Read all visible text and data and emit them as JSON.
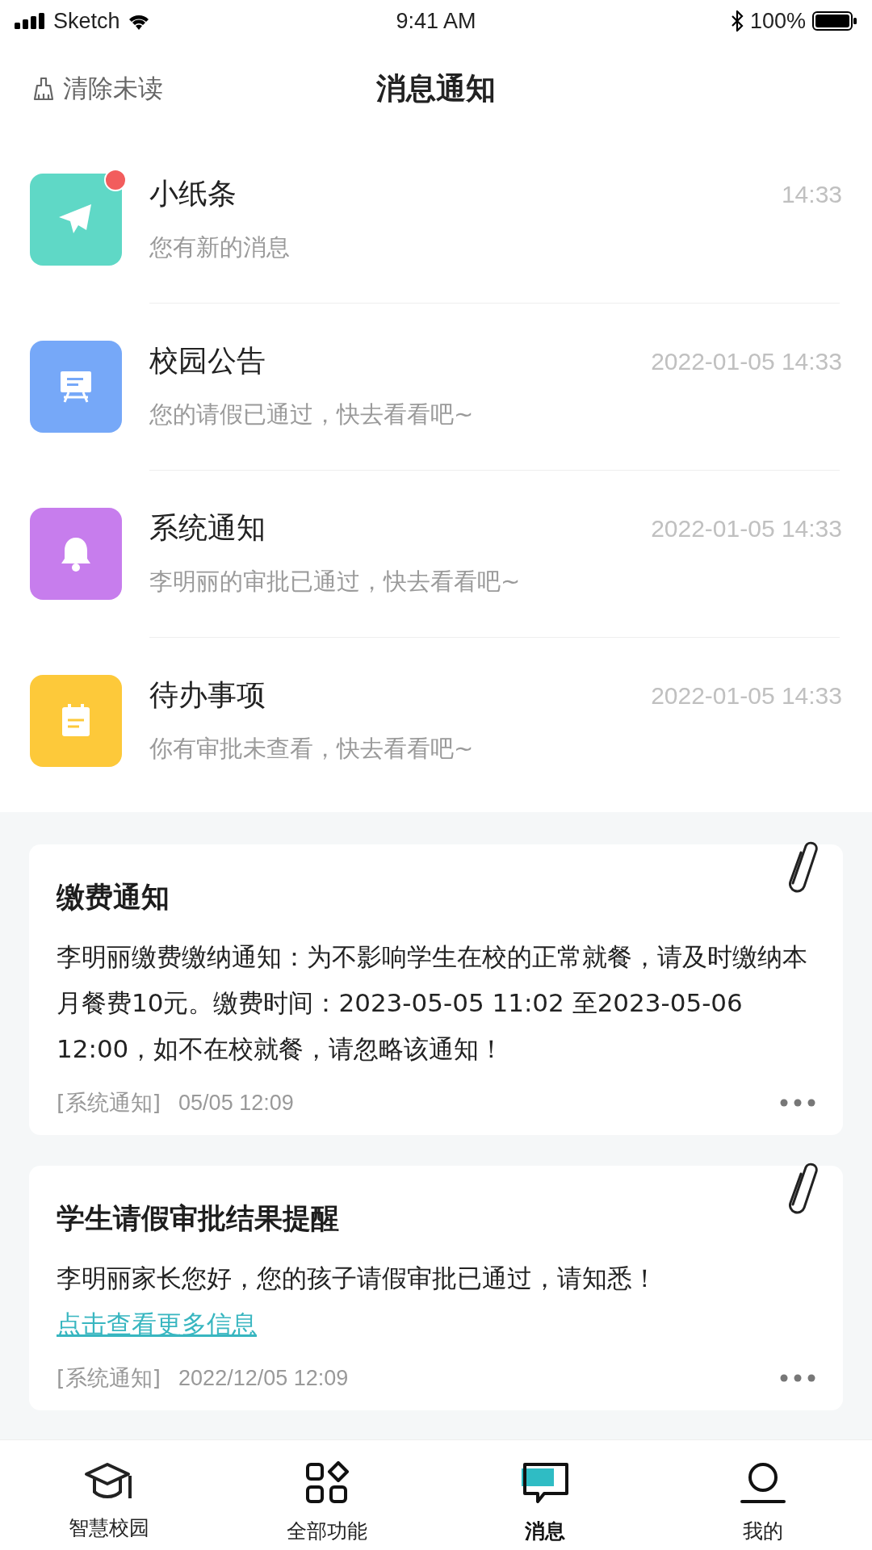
{
  "status_bar": {
    "carrier": "Sketch",
    "time": "9:41 AM",
    "battery": "100%"
  },
  "header": {
    "action": "清除未读",
    "title": "消息通知"
  },
  "messages": [
    {
      "kind": "plane",
      "color": "#5fd8c6",
      "title": "小纸条",
      "preview": "您有新的消息",
      "time": "14:33",
      "unread": true
    },
    {
      "kind": "board",
      "color": "#76a8f8",
      "title": "校园公告",
      "preview": "您的请假已通过，快去看看吧~",
      "time": "2022-01-05 14:33",
      "unread": false
    },
    {
      "kind": "bell",
      "color": "#c77ded",
      "title": "系统通知",
      "preview": "李明丽的审批已通过，快去看看吧~",
      "time": "2022-01-05 14:33",
      "unread": false
    },
    {
      "kind": "note",
      "color": "#fdc93a",
      "title": "待办事项",
      "preview": "你有审批未查看，快去看看吧~",
      "time": "2022-01-05 14:33",
      "unread": false
    }
  ],
  "notices": [
    {
      "title": "缴费通知",
      "body": "李明丽缴费缴纳通知：为不影响学生在校的正常就餐，请及时缴纳本月餐费10元。缴费时间：2023-05-05 11:02 至2023-05-06 12:00，如不在校就餐，请忽略该通知！",
      "source": "[系统通知]",
      "time": "05/05 12:09"
    },
    {
      "title": "学生请假审批结果提醒",
      "body": "李明丽家长您好，您的孩子请假审批已通过，请知悉！",
      "link": "点击查看更多信息",
      "source": "[系统通知]",
      "time": "2022/12/05 12:09"
    }
  ],
  "tabs": [
    {
      "kind": "campus",
      "label": "智慧校园",
      "selected": false
    },
    {
      "kind": "apps",
      "label": "全部功能",
      "selected": false
    },
    {
      "kind": "chat",
      "label": "消息",
      "selected": true
    },
    {
      "kind": "me",
      "label": "我的",
      "selected": false
    }
  ]
}
